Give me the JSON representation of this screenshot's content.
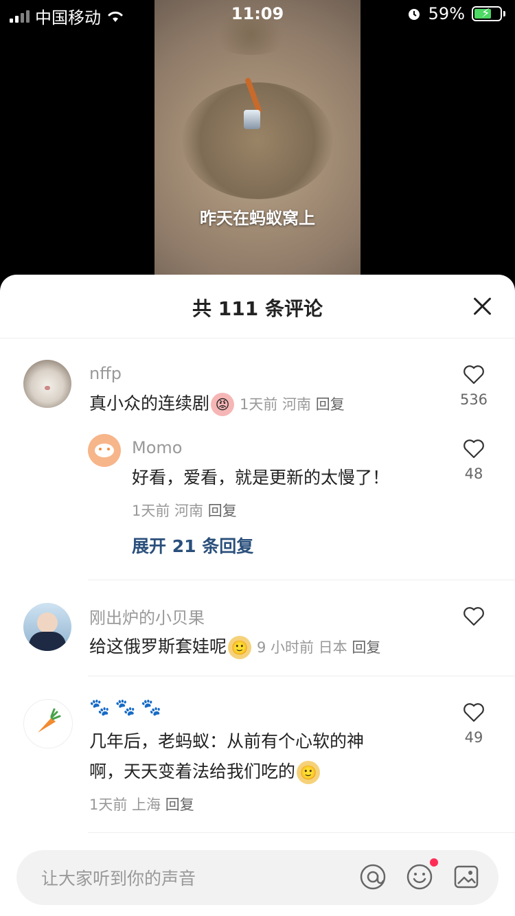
{
  "status_bar": {
    "carrier": "中国移动",
    "time": "11:09",
    "battery": "59%"
  },
  "video": {
    "caption": "昨天在蚂蚁窝上"
  },
  "comments_sheet": {
    "title": "共 111 条评论",
    "comments": [
      {
        "username": "nffp",
        "text": "真小众的连续剧",
        "meta": "1天前 河南",
        "reply_label": "回复",
        "likes": "536",
        "replies": [
          {
            "username": "Momo",
            "text": "好看，爱看，就是更新的太慢了！",
            "meta": "1天前 河南",
            "reply_label": "回复",
            "likes": "48"
          }
        ],
        "expand_label": "展开 21 条回复"
      },
      {
        "username": "刚出炉的小贝果",
        "text": "给这俄罗斯套娃呢",
        "meta": "9 小时前 日本",
        "reply_label": "回复",
        "likes": ""
      },
      {
        "username": "🐾 🐾 🐾",
        "text_line1": "几年后，老蚂蚁：从前有个心软的神",
        "text_line2": "啊，天天变着法给我们吃的",
        "meta": "1天前 上海",
        "reply_label": "回复",
        "likes": "49"
      }
    ]
  },
  "bottom_bar": {
    "placeholder": "让大家听到你的声音"
  }
}
